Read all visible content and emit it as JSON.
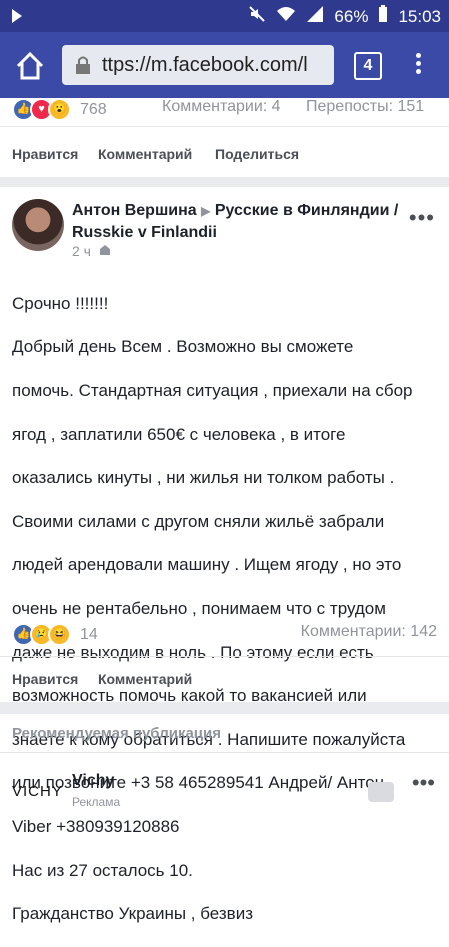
{
  "status_bar": {
    "left_icon": "vibrate-icon",
    "battery": "66%",
    "time": "15:03"
  },
  "browser": {
    "url": "ttps://m.facebook.com/l",
    "tabs_count": "4"
  },
  "prev_post": {
    "reaction_count": "768",
    "comments": "Комментарии: 4",
    "shares": "Перепосты: 151",
    "actions": {
      "like": "Нравится",
      "comment": "Комментарий",
      "share": "Поделиться"
    }
  },
  "post": {
    "author": "Антон Вершина",
    "group": "Русские в Финляндии / Russkie v Finlandii",
    "time": "2 ч",
    "lines": [
      "Срочно !!!!!!!",
      "Добрый день Всем . Возможно вы сможете",
      "помочь. Стандартная ситуация , приехали на сбор",
      "ягод , заплатили 650€ с человека , в итоге",
      "оказались кинуты , ни жилья ни толком работы .",
      "Своими силами с другом сняли жильё забрали",
      "людей арендовали машину . Ищем ягоду , но это",
      "очень не рентабельно , понимаем что с трудом",
      "даже не выходим в ноль . По этому если есть",
      "возможность помочь какой то вакансией или",
      "знаете к кому обратиться . Напишите пожалуйста",
      "или позвоните +3 58 465289541 Андрей/ Антон",
      "Viber +380939120886",
      "Нас из 27 осталось 10.",
      "Гражданство Украины , безвиз"
    ],
    "reaction_count": "14",
    "comments": "Комментарии: 142",
    "actions": {
      "like": "Нравится",
      "comment": "Комментарий"
    }
  },
  "suggested": {
    "header": "Рекомендуемая публикация",
    "logo_text": "VICHY",
    "name": "Vichy",
    "subtitle": "Реклама"
  }
}
